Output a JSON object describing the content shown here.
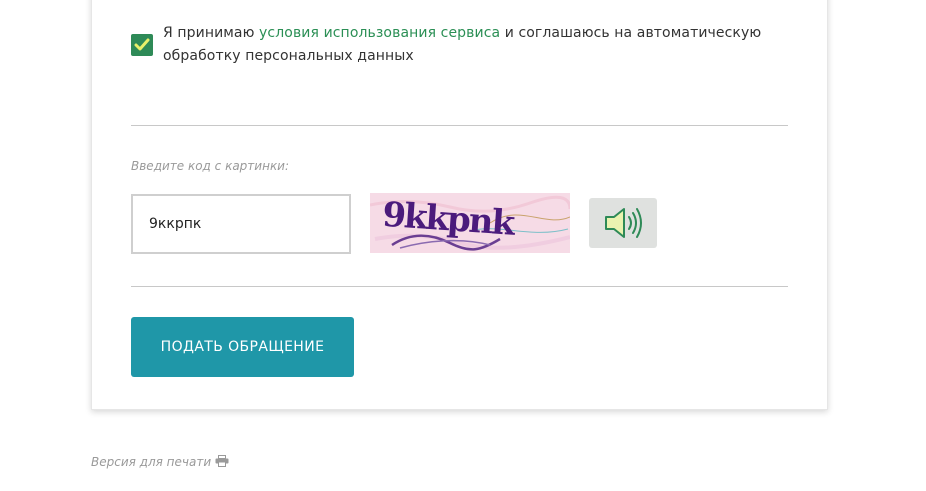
{
  "consent": {
    "checked": true,
    "text_before": "Я принимаю ",
    "link_text": "условия использования сервиса",
    "text_after": " и соглашаюсь на автоматическую обработку персональных данных"
  },
  "captcha": {
    "label": "Введите код с картинки:",
    "input_value": "9ккрпк",
    "image_text": "9kkpnk",
    "audio_icon": "speaker-icon"
  },
  "form": {
    "submit_label": "ПОДАТЬ ОБРАЩЕНИЕ"
  },
  "footer": {
    "print_label": "Версия для печати",
    "print_icon": "printer-icon"
  },
  "colors": {
    "accent_green": "#2e8a57",
    "submit_teal": "#1f97a8",
    "captcha_ink": "#4b1b7c"
  }
}
